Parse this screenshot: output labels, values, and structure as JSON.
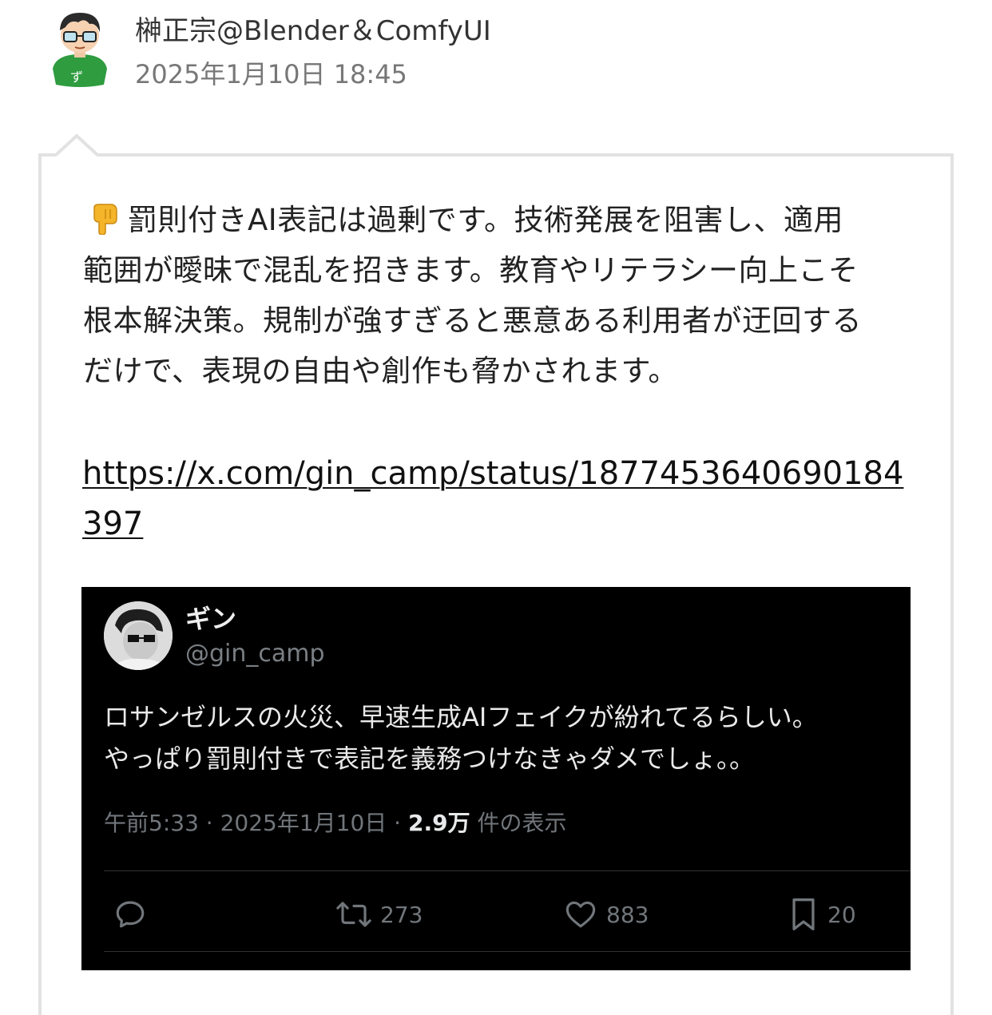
{
  "post": {
    "author": "榊正宗@Blender＆ComfyUI",
    "date": "2025年1月10日 18:45",
    "text": "罰則付きAI表記は過剰です。技術発展を阻害し、適用範囲が曖昧で混乱を招きます。教育やリテラシー向上こそ根本解決策。規制が強すぎると悪意ある利用者が迂回するだけで、表現の自由や創作も脅かされます。",
    "text_lines": [
      "罰則付きAI表記は過剰です。技術発展を阻害し、適用",
      "範囲が曖昧で混乱を招きます。教育やリテラシー向上こそ",
      "根本解決策。規制が強すぎると悪意ある利用者が迂回する",
      "だけで、表現の自由や創作も脅かされます。"
    ],
    "leading_emoji": "backhand-index-pointing-down",
    "link": "https://x.com/gin_camp/status/1877453640690184397"
  },
  "embedded_tweet": {
    "name": "ギン",
    "handle": "@gin_camp",
    "body_lines": [
      "ロサンゼルスの火災、早速生成AIフェイクが紛れてるらしい。",
      "やっぱり罰則付きで表記を義務つけなきゃダメでしょ。。"
    ],
    "meta_prefix": "午前5:33 · 2025年1月10日 · ",
    "views": "2.9万",
    "views_suffix": " 件の表示",
    "actions": {
      "reply": {
        "icon": "reply-icon",
        "count": ""
      },
      "retweet": {
        "icon": "retweet-icon",
        "count": "273"
      },
      "like": {
        "icon": "heart-icon",
        "count": "883"
      },
      "bookmark": {
        "icon": "bookmark-icon",
        "count": "20"
      }
    }
  },
  "colors": {
    "bubble_border": "#e2e2e2",
    "tweet_background": "#000000",
    "tweet_secondary_text": "#71767b",
    "avatar_shirt": "#2e9c3f",
    "emoji_yellow": "#f5b52b"
  }
}
